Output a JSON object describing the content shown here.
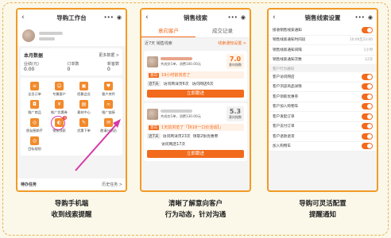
{
  "phone1": {
    "title": "导购工作台",
    "stats_header": "本月数据",
    "stats_more": "更多数据 >",
    "stat_labels": [
      "业绩(元)",
      "订单数",
      "新客数"
    ],
    "stat_values": [
      "0.00",
      "0",
      "0"
    ],
    "tools": [
      "全员订单",
      "专属客户",
      "招募会员",
      "客户关怀",
      "推广商品",
      "推广优惠券",
      "素材中心",
      "推广链接",
      "朋友圈助手",
      "销售线索",
      "优惠下单",
      "邀请分销员",
      "目标规划"
    ],
    "badge": "6",
    "footer_left": "待办任务",
    "footer_right": "历史任务 >"
  },
  "phone2": {
    "title": "销售线索",
    "tabs": [
      "意向客户",
      "成交记录"
    ],
    "filter_left": "近7天 销售线索",
    "filter_right": "线索通知设置 >",
    "lead1": {
      "meta": "共成交1单，消费100.00元",
      "score": "7.0",
      "score_label": "意向指数",
      "alert_tag": "意向",
      "alert_text": "19小时前浏览了",
      "chip": "近7天",
      "visits": "访问商详页6次",
      "shop": "访问网店6次",
      "button": "立即跟进"
    },
    "lead2": {
      "meta": "共成交1单，消费130.00元",
      "score": "5.3",
      "score_label": "意向指数",
      "alert_tag": "意向",
      "alert_text": "1天前浏览了「【618一口价活动】」",
      "chip": "近7天",
      "visits": "访问商详页23次",
      "coupon": "领取2张优惠券",
      "shop": "访问网店17次",
      "button": "立即跟进"
    }
  },
  "phone3": {
    "title": "销售线索设置",
    "rows_top": [
      {
        "label": "接收销售线索通知",
        "value": ""
      },
      {
        "label": "销售线索通知时间段",
        "value": "10:00至22:00"
      },
      {
        "label": "销售线索通知间隔",
        "value": "1小时"
      },
      {
        "label": "销售线索通知次数",
        "value": "12次"
      }
    ],
    "section_label": "客户行为通知",
    "rows_bottom": [
      "客户访问网店",
      "客户浏览商品详情",
      "客户领取优惠券",
      "客户加入购物车",
      "客户发起订单",
      "客户支付订单",
      "客户退款退货",
      "加入购物车"
    ]
  },
  "captions": [
    [
      "导购手机端",
      "收到线索提醒"
    ],
    [
      "清晰了解意向客户",
      "行为动态，针对沟通"
    ],
    [
      "导购可灵活配置",
      "提醒通知"
    ]
  ],
  "colors": {
    "accent": "#f26a1b",
    "frame": "#f29a26",
    "highlight": "#d63aa8"
  }
}
